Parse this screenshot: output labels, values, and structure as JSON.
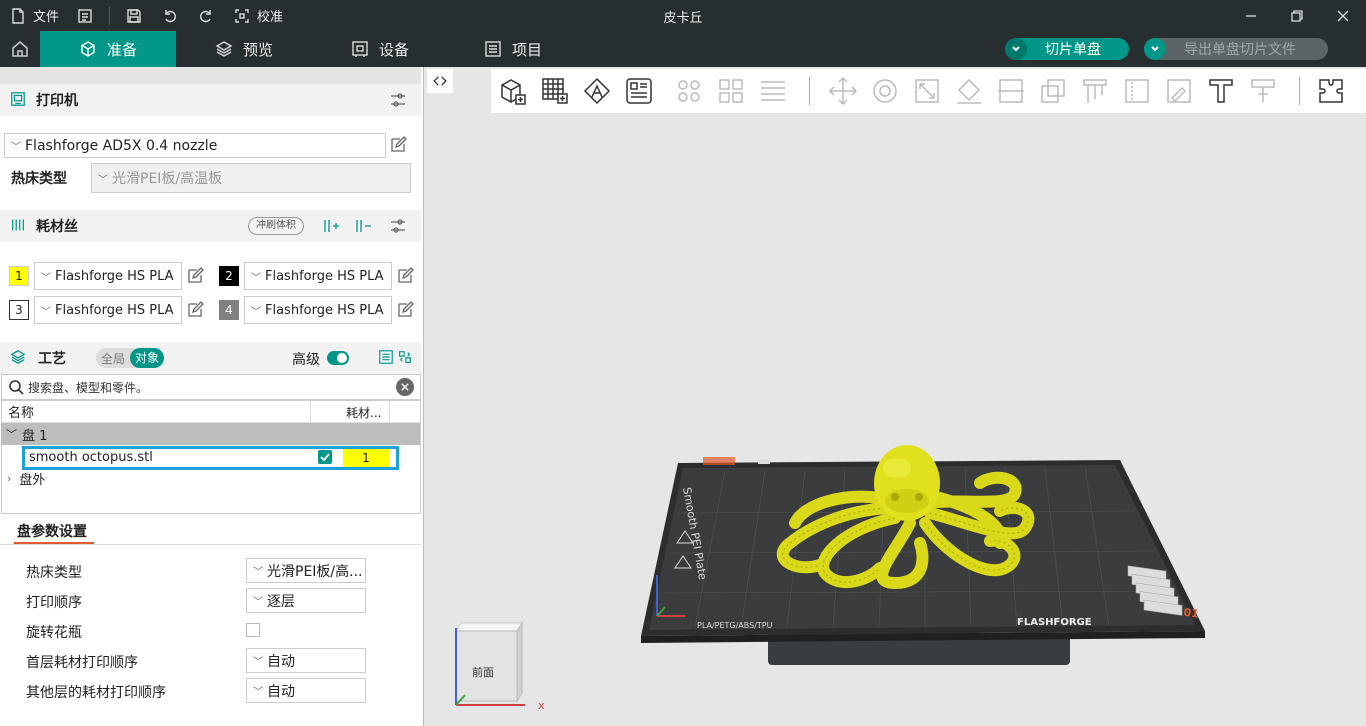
{
  "titlebar": {
    "file_label": "文件",
    "calibrate_label": "校准",
    "app_title": "皮卡丘"
  },
  "nav": {
    "tabs": [
      {
        "label": "准备",
        "active": true
      },
      {
        "label": "预览",
        "active": false
      },
      {
        "label": "设备",
        "active": false
      },
      {
        "label": "项目",
        "active": false
      }
    ],
    "slice_button": "切片单盘",
    "export_button": "导出单盘切片文件"
  },
  "printer": {
    "section_title": "打印机",
    "selected": "Flashforge AD5X 0.4 nozzle",
    "bed_type_label": "热床类型",
    "bed_type_value": "光滑PEI板/高温板"
  },
  "filament": {
    "section_title": "耗材丝",
    "flush_button": "冲刷体积",
    "slots": [
      {
        "num": "1",
        "name": "Flashforge HS PLA",
        "color": "#ffff00",
        "text_color": "#000000"
      },
      {
        "num": "2",
        "name": "Flashforge HS PLA",
        "color": "#000000",
        "text_color": "#ffffff"
      },
      {
        "num": "3",
        "name": "Flashforge HS PLA",
        "color": "#ffffff",
        "text_color": "#000000"
      },
      {
        "num": "4",
        "name": "Flashforge HS PLA",
        "color": "#808080",
        "text_color": "#ffffff"
      }
    ]
  },
  "process": {
    "section_title": "工艺",
    "toggle_global": "全局",
    "toggle_object": "对象",
    "advanced_label": "高级",
    "search_placeholder": "搜索盘、模型和零件。",
    "col_name": "名称",
    "col_filament": "耗材...",
    "plate_label": "盘 1",
    "object_name": "smooth octopus.stl",
    "object_filament": "1",
    "outside_label": "盘外"
  },
  "plate_params": {
    "title": "盘参数设置",
    "rows": [
      {
        "label": "热床类型",
        "value": "光滑PEI板/高..."
      },
      {
        "label": "打印顺序",
        "value": "逐层"
      },
      {
        "label": "旋转花瓶",
        "value": ""
      },
      {
        "label": "首层耗材打印顺序",
        "value": "自动"
      },
      {
        "label": "其他层的耗材打印顺序",
        "value": "自动"
      }
    ]
  },
  "viewport": {
    "view_cube_label": "前面",
    "plate_text_1": "Smooth PEI Plate",
    "plate_text_2": "PLA/PETG/ABS/TPU",
    "plate_brand": "FLASHFORGE",
    "plate_number": "01",
    "axis_x": "x"
  },
  "colors": {
    "accent": "#009688",
    "titlebar": "#262e30",
    "model": "#e6e619"
  }
}
